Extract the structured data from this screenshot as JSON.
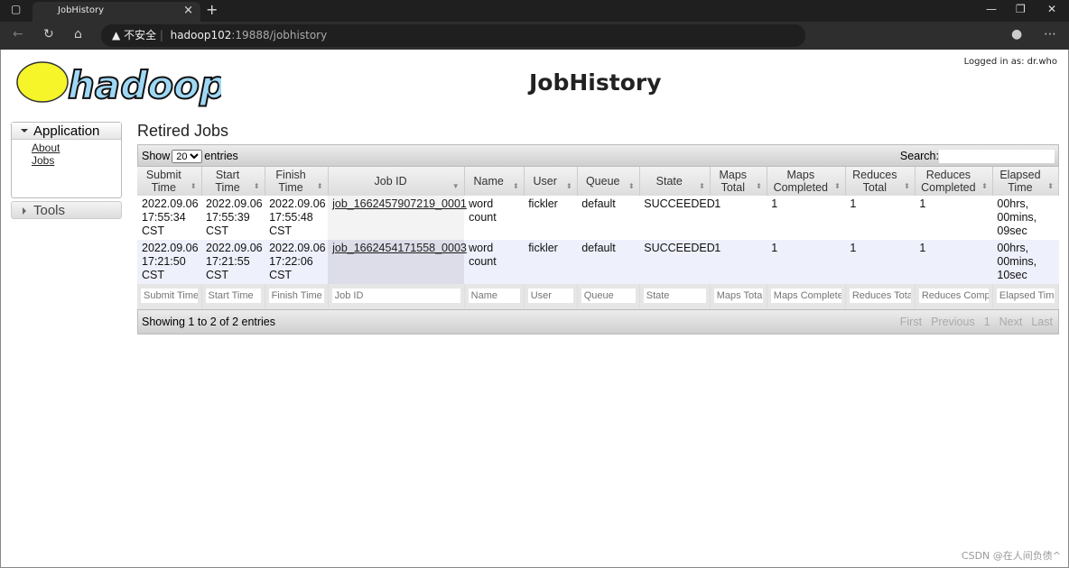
{
  "browser": {
    "tab_title": "JobHistory",
    "security_label": "不安全",
    "url_host": "hadoop102",
    "url_rest": ":19888/jobhistory"
  },
  "header": {
    "title": "JobHistory",
    "logged_in": "Logged in as: dr.who",
    "logo_text": "hadoop"
  },
  "sidebar": {
    "application": "Application",
    "links": [
      "About",
      "Jobs"
    ],
    "tools": "Tools"
  },
  "main": {
    "heading": "Retired Jobs",
    "show_label": "Show",
    "page_size": "20",
    "entries_label": "entries",
    "search_label": "Search:",
    "search_value": "",
    "columns": [
      [
        "Submit",
        "Time"
      ],
      [
        "Start Time",
        ""
      ],
      [
        "Finish",
        "Time"
      ],
      [
        "Job ID",
        ""
      ],
      [
        "Name",
        ""
      ],
      [
        "User",
        ""
      ],
      [
        "Queue",
        ""
      ],
      [
        "State",
        ""
      ],
      [
        "Maps",
        "Total"
      ],
      [
        "Maps",
        "Completed"
      ],
      [
        "Reduces",
        "Total"
      ],
      [
        "Reduces",
        "Completed"
      ],
      [
        "Elapsed",
        "Time"
      ]
    ],
    "rows": [
      [
        "2022.09.06 17:55:34 CST",
        "2022.09.06 17:55:39 CST",
        "2022.09.06 17:55:48 CST",
        "job_1662457907219_0001",
        "word count",
        "fickler",
        "default",
        "SUCCEEDED",
        "1",
        "1",
        "1",
        "1",
        "00hrs, 00mins, 09sec"
      ],
      [
        "2022.09.06 17:21:50 CST",
        "2022.09.06 17:21:55 CST",
        "2022.09.06 17:22:06 CST",
        "job_1662454171558_0003",
        "word count",
        "fickler",
        "default",
        "SUCCEEDED",
        "1",
        "1",
        "1",
        "1",
        "00hrs, 00mins, 10sec"
      ]
    ],
    "filters": [
      "Submit Time",
      "Start Time",
      "Finish Time",
      "Job ID",
      "Name",
      "User",
      "Queue",
      "State",
      "Maps Total",
      "Maps Completed",
      "Reduces Total",
      "Reduces Completed",
      "Elapsed Time"
    ],
    "info": "Showing 1 to 2 of 2 entries",
    "pager": [
      "First",
      "Previous",
      "1",
      "Next",
      "Last"
    ]
  },
  "watermark": "CSDN @在人间负债^"
}
